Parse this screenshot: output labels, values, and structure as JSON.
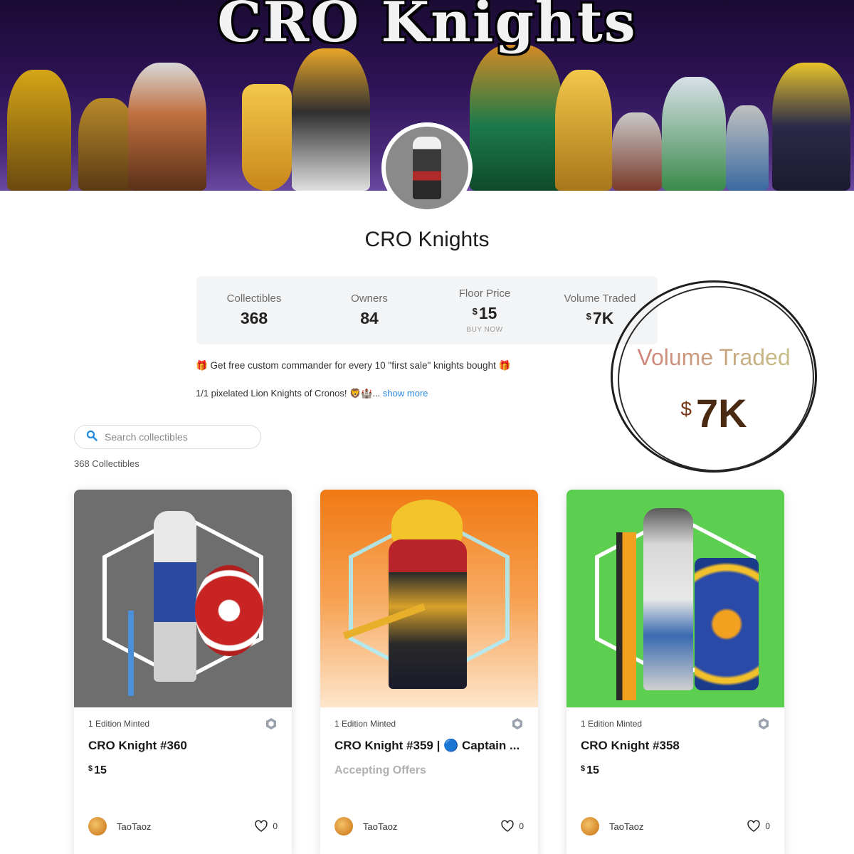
{
  "banner": {
    "title": "CRO Knights"
  },
  "collection": {
    "title": "CRO Knights"
  },
  "stats": [
    {
      "label": "Collectibles",
      "value": "368"
    },
    {
      "label": "Owners",
      "value": "84"
    },
    {
      "label": "Floor Price",
      "currency": "$",
      "value": "15",
      "sub": "BUY NOW"
    },
    {
      "label": "Volume Traded",
      "currency": "$",
      "value": "7K"
    }
  ],
  "description": {
    "line1": "🎁 Get free custom commander for every 10 \"first sale\" knights bought 🎁",
    "line2": "1/1 pixelated Lion Knights of Cronos! 🦁🏰...",
    "show_more": "show more"
  },
  "callout": {
    "label": "Volume Traded",
    "currency": "$",
    "value": "7K"
  },
  "search": {
    "placeholder": "Search collectibles"
  },
  "count_label": "368 Collectibles",
  "cards": [
    {
      "edition": "1 Edition Minted",
      "name": "CRO Knight #360",
      "currency": "$",
      "price": "15",
      "owner": "TaoTaoz",
      "likes": "0",
      "bg": "#6e6e6e"
    },
    {
      "edition": "1 Edition Minted",
      "name": "CRO Knight #359 | 🔵 Captain ...",
      "status": "Accepting Offers",
      "owner": "TaoTaoz",
      "likes": "0",
      "bg": "#f08020"
    },
    {
      "edition": "1 Edition Minted",
      "name": "CRO Knight #358",
      "currency": "$",
      "price": "15",
      "owner": "TaoTaoz",
      "likes": "0",
      "bg": "#5ccf50"
    }
  ]
}
